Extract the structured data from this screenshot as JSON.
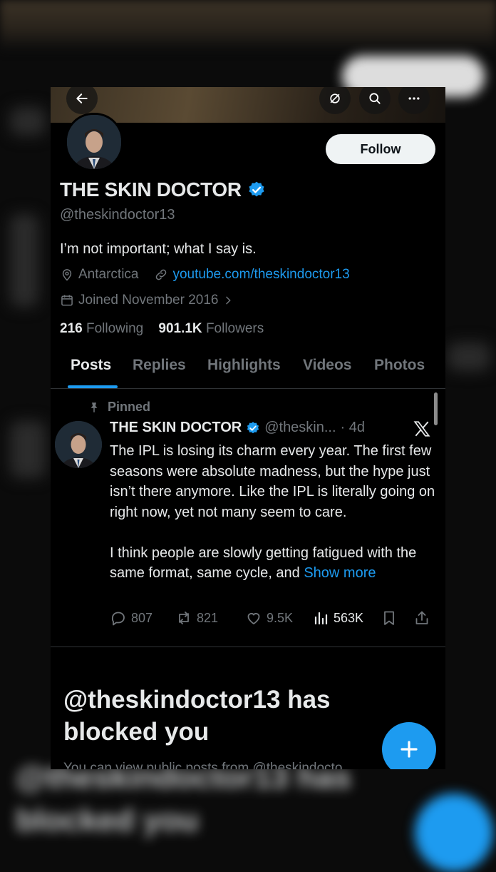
{
  "profile": {
    "display_name": "THE SKIN DOCTOR",
    "handle": "@theskindoctor13",
    "bio": "I’m not important; what I say is.",
    "location": "Antarctica",
    "website": "youtube.com/theskindoctor13",
    "joined": "Joined November 2016",
    "following_count": "216",
    "following_label": "Following",
    "followers_count": "901.1K",
    "followers_label": "Followers"
  },
  "header": {
    "follow_label": "Follow"
  },
  "tabs": [
    {
      "label": "Posts",
      "active": true
    },
    {
      "label": "Replies"
    },
    {
      "label": "Highlights"
    },
    {
      "label": "Videos"
    },
    {
      "label": "Photos"
    }
  ],
  "pinned_post": {
    "pinned_label": "Pinned",
    "author": "THE SKIN DOCTOR",
    "handle": "@theskin...",
    "time": "· 4d",
    "text": "The IPL is losing its charm every year. The first few seasons were absolute madness, but the hype just isn’t there anymore. Like the IPL is literally going on right now, yet not many seem to care.\n\nI think people are slowly getting fatigued with the same format, same cycle, and ",
    "show_more": "Show more",
    "replies": "807",
    "reposts": "821",
    "likes": "9.5K",
    "views": "563K"
  },
  "blocked": {
    "title": "@theskindoctor13 has blocked you",
    "subtitle": "You can view public posts from @theskindocto"
  },
  "colors": {
    "accent": "#1d9bf0",
    "background": "#000000",
    "muted": "#71767b"
  },
  "icons": [
    "back-arrow-icon",
    "grok-icon",
    "search-icon",
    "more-icon",
    "verified-icon",
    "location-icon",
    "link-icon",
    "calendar-icon",
    "chevron-right-icon",
    "pin-icon",
    "x-logo-icon",
    "reply-icon",
    "repost-icon",
    "like-icon",
    "views-icon",
    "bookmark-icon",
    "share-icon",
    "plus-icon"
  ]
}
